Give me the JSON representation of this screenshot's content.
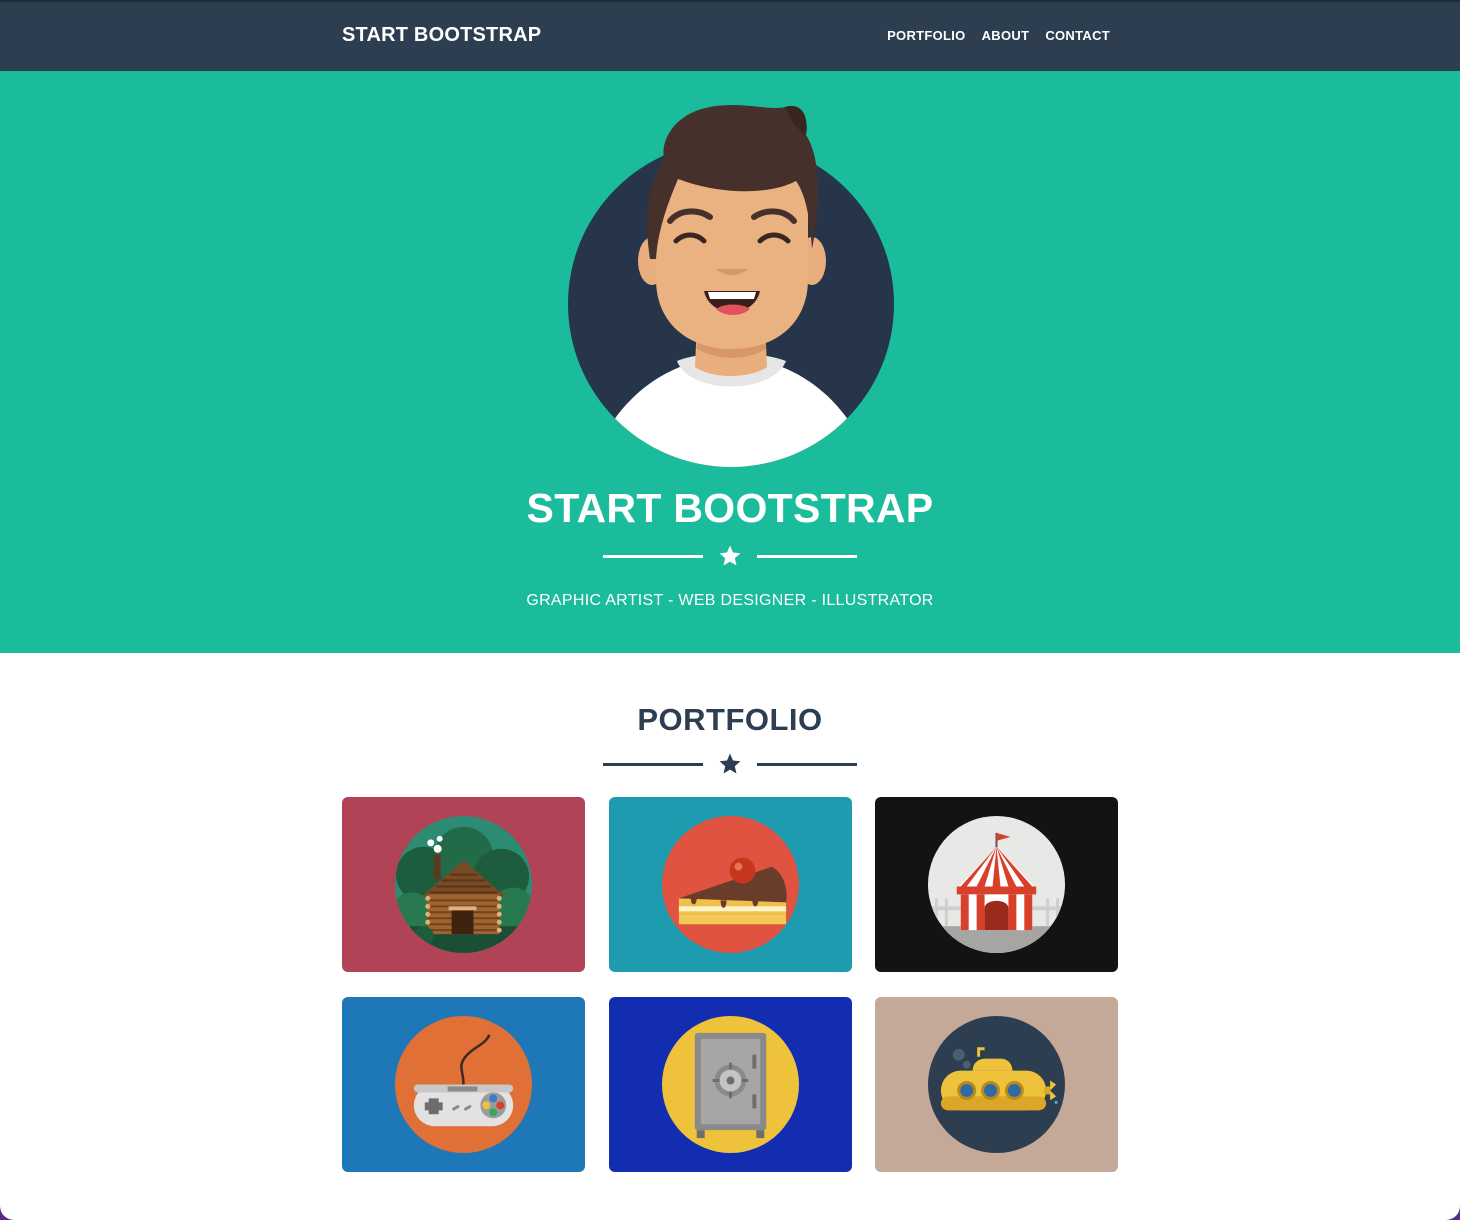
{
  "navbar": {
    "brand": "START BOOTSTRAP",
    "links": [
      "PORTFOLIO",
      "ABOUT",
      "CONTACT"
    ]
  },
  "masthead": {
    "title": "START BOOTSTRAP",
    "subtitle": "GRAPHIC ARTIST - WEB DESIGNER - ILLUSTRATOR"
  },
  "portfolio": {
    "title": "PORTFOLIO",
    "items": [
      {
        "icon": "cabin-icon",
        "bg": "#b04356"
      },
      {
        "icon": "cake-icon",
        "bg": "#1f9bb0"
      },
      {
        "icon": "circus-tent-icon",
        "bg": "#141311"
      },
      {
        "icon": "game-controller-icon",
        "bg": "#1e78b8"
      },
      {
        "icon": "safe-icon",
        "bg": "#132db0"
      },
      {
        "icon": "submarine-icon",
        "bg": "#c4a898"
      }
    ]
  },
  "colors": {
    "navbar": "#2c3e50",
    "primary": "#1abc9c",
    "text_dark": "#2c3e50",
    "white": "#ffffff"
  }
}
